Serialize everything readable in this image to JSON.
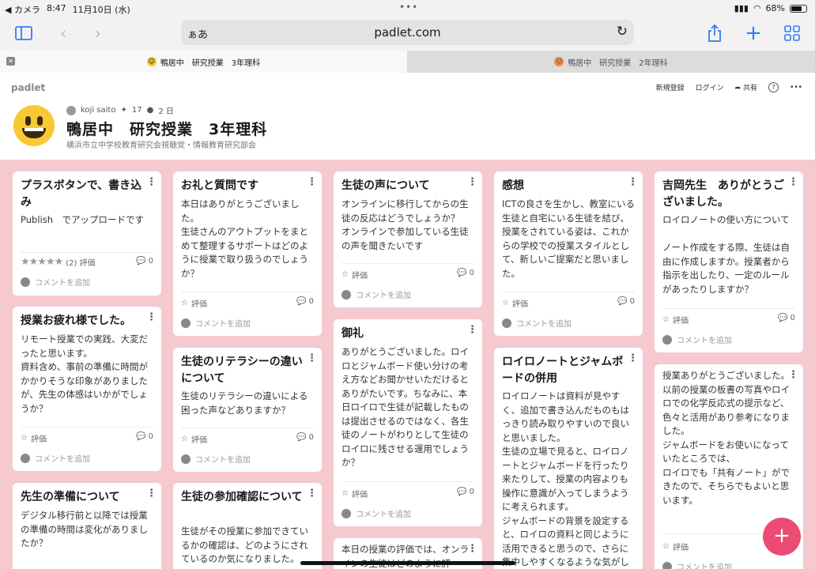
{
  "status": {
    "carrier": "◀ カメラ",
    "time": "8:47",
    "date": "11月10日 (水)",
    "battery": "68%"
  },
  "browser": {
    "aa": "ぁあ",
    "url": "padlet.com"
  },
  "tabs": [
    {
      "label": "鴨居中　研究授業　3年理科"
    },
    {
      "label": "鴨居中　研究授業　2年理科"
    }
  ],
  "header": {
    "logo": "padlet",
    "signup": "新規登録",
    "login": "ログイン",
    "share": "共有",
    "help": "?",
    "more": "•••",
    "author": "koji saito",
    "likes": "17",
    "age": "2 日",
    "title": "鴨居中　研究授業　3年理科",
    "subtitle": "横浜市立中学校教育研究会視聴覚・情報教育研究部会"
  },
  "cards": [
    {
      "title": "プラスボタンで、書き込み",
      "body": "Publish　でアップロードです",
      "rating": "(2) 評価",
      "count": "0",
      "comment": "コメントを追加",
      "stars": "★★★★★"
    },
    {
      "title": "授業お疲れ様でした。",
      "body": "リモート授業での実践、大変だったと思います。\n資料含め、事前の準備に時間がかかりそうな印象がありましたが、先生の体感はいかがでしょうか？",
      "rating": "評価",
      "count": "0",
      "comment": "コメントを追加"
    },
    {
      "title": "先生の準備について",
      "body": "デジタル移行前と以降では授業の準備の時間は変化がありましたか？"
    },
    {
      "title": "お礼と質問です",
      "body": "本日はありがとうございました。\n生徒さんのアウトプットをまとめて整理するサポートはどのように授業で取り扱うのでしょうか？",
      "rating": "評価",
      "count": "0",
      "comment": "コメントを追加"
    },
    {
      "title": "生徒のリテラシーの違いについて",
      "body": "生徒のリテラシーの違いによる困った声などありますか？",
      "rating": "評価",
      "count": "0",
      "comment": "コメントを追加"
    },
    {
      "title": "生徒の参加確認について",
      "body": "生徒がその授業に参加できているかの確認は、どのようにされているのか気になりました。"
    },
    {
      "title": "生徒の声について",
      "body": "オンラインに移行してからの生徒の反応はどうでしょうか？\nオンラインで参加している生徒の声を聞きたいです",
      "rating": "評価",
      "count": "0",
      "comment": "コメントを追加"
    },
    {
      "title": "御礼",
      "body": "ありがとうございました。ロイロとジャムボード使い分けの考え方などお聞かせいただけるとありがたいです。ちなみに、本日ロイロで生徒が記載したものは提出させるのではなく、各生徒のノートがわりとして生徒のロイロに残させる運用でしょうか？",
      "rating": "評価",
      "count": "0",
      "comment": "コメントを追加"
    },
    {
      "body": "本日の授業の評価では、オンラインの生徒はどのように評"
    },
    {
      "title": "感想",
      "body": "ICTの良さを生かし、教室にいる生徒と自宅にいる生徒を結び、授業をされている姿は、これからの学校での授業スタイルとして、新しいご提案だと思いました。",
      "rating": "評価",
      "count": "0",
      "comment": "コメントを追加"
    },
    {
      "title": "ロイロノートとジャムボードの併用",
      "body": "ロイロノートは資料が見やすく、追加で書き込んだものもはっきり読み取りやすいので良いと思いました。\n生徒の立場で見ると、ロイロノートとジャムボードを行ったり来たりして、授業の内容よりも操作に意識が入ってしまうように考えられます。\nジャムボードの背景を設定すると、ロイロの資料と同じように活用できると思うので、さらに集中しやすくなるような気がし"
    },
    {
      "title": "吉岡先生　ありがとうございました。",
      "body": "ロイロノートの使い方について\n\nノート作成をする際、生徒は自由に作成しますか。授業者から指示を出したり、一定のルールがあったりしますか？",
      "rating": "評価",
      "count": "0",
      "comment": "コメントを追加"
    },
    {
      "body": "授業ありがとうございました。\n以前の授業の板書の写真やロイロでの化学反応式の提示など、色々と活用があり参考になりました。\nジャムボードをお使いになっていたところでは、\nロイロでも「共有ノート」ができたので、そちらでもよいと思います。",
      "rating": "評価",
      "comment": "コメントを追加"
    }
  ],
  "fab": "+"
}
